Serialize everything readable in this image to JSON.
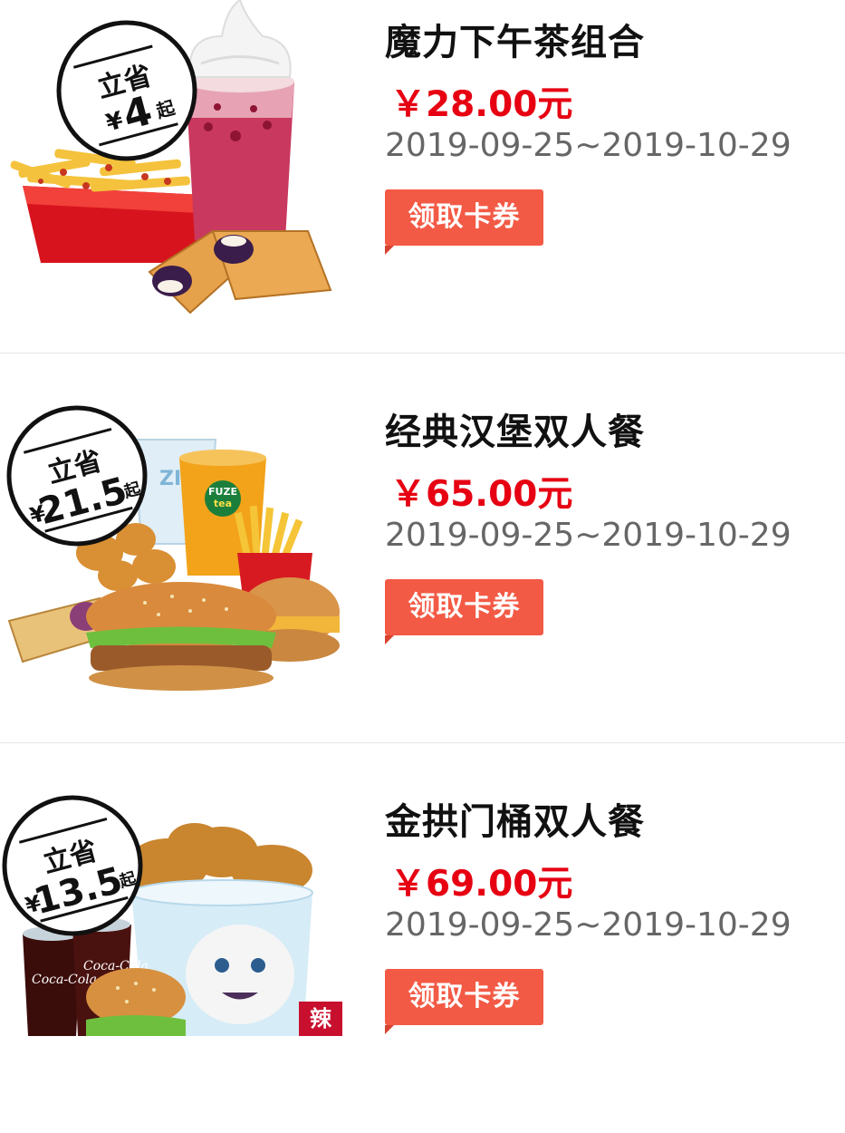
{
  "offers": [
    {
      "title": "魔力下午茶组合",
      "price": "￥28.00元",
      "date_range": "2019-09-25~2019-10-29",
      "claim_label": "领取卡券",
      "badge": {
        "line1": "立省",
        "currency": "¥",
        "amount": "4",
        "suffix": "起"
      }
    },
    {
      "title": "经典汉堡双人餐",
      "price": "￥65.00元",
      "date_range": "2019-09-25~2019-10-29",
      "claim_label": "领取卡券",
      "badge": {
        "line1": "立省",
        "currency": "¥",
        "amount": "21.5",
        "suffix": "起"
      }
    },
    {
      "title": "金拱门桶双人餐",
      "price": "￥69.00元",
      "date_range": "2019-09-25~2019-10-29",
      "claim_label": "领取卡券",
      "badge": {
        "line1": "立省",
        "currency": "¥",
        "amount": "13.5",
        "suffix": "起"
      },
      "tag": "辣"
    }
  ],
  "colors": {
    "price": "#e60012",
    "claim_button": "#f35a45",
    "title": "#111111",
    "date": "#666666"
  }
}
